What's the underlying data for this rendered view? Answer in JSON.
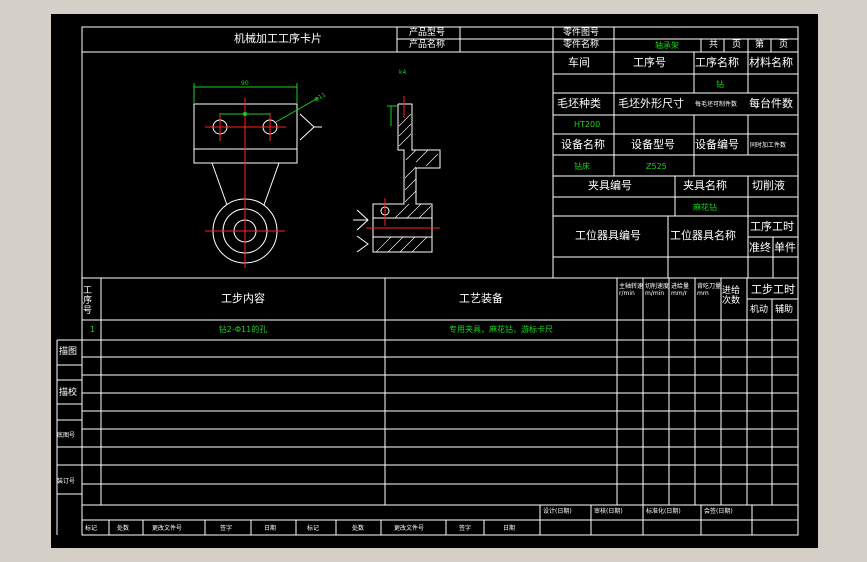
{
  "card": {
    "title": "机械加工工序卡片",
    "product_model_label": "产品型号",
    "product_name_label": "产品名称",
    "part_number_label": "零件图号",
    "part_name_label": "零件名称",
    "part_name_value": "轴承架",
    "total_label": "共",
    "page_label": "页",
    "sheet_label": "第",
    "sheet_page_label": "页"
  },
  "info": {
    "workshop": "车间",
    "process_no": "工序号",
    "process_name": "工序名称",
    "material": "材料名称",
    "process_name_value": "钻",
    "blank_type": "毛坯种类",
    "blank_size": "毛坯外形尺寸",
    "blank_pieces": "每毛坯可制件数",
    "per_unit": "每台件数",
    "blank_type_value": "HT200",
    "equip_name": "设备名称",
    "equip_model": "设备型号",
    "equip_no": "设备编号",
    "concurrent": "同时加工件数",
    "equip_name_value": "钻床",
    "equip_model_value": "Z525",
    "fixture_no": "夹具编号",
    "fixture_name": "夹具名称",
    "coolant": "切削液",
    "fixture_name_value": "麻花钻",
    "station_tool_no": "工位器具编号",
    "station_tool_name": "工位器具名称",
    "proc_time": "工序工时",
    "prep_time": "准终",
    "unit_time": "单件"
  },
  "steps": {
    "headers": {
      "step_no": "工序号",
      "content": "工步内容",
      "equipment": "工艺装备",
      "spindle_speed": "主轴转速 r/min",
      "cut_speed": "切削速度 m/min",
      "feed": "进给量 mm/r",
      "depth": "背吃刀量 mm",
      "passes": "进给次数",
      "step_time": "工步工时",
      "machine": "机动",
      "aux": "辅助"
    },
    "rows": [
      {
        "no": "1",
        "content": "钻2-Φ11的孔",
        "equipment": "专用夹具，麻花钻，游标卡尺"
      }
    ]
  },
  "side_labels": {
    "trace": "描图",
    "proof": "描校",
    "base_no": "底图号",
    "binding_no": "装订号"
  },
  "footer": {
    "design": "设计(日期)",
    "review": "审核(日期)",
    "standard": "标准化(日期)",
    "sign": "会签(日期)",
    "cols": [
      "标记",
      "处数",
      "更改文件号",
      "签字",
      "日期",
      "标记",
      "处数",
      "更改文件号",
      "签字",
      "日期"
    ]
  },
  "drawing": {
    "note_label": "k4",
    "dim_label": "90",
    "dim2_label": "Φ11"
  },
  "colors": {
    "background": "#000000",
    "lines": "#ffffff",
    "values": "#19d219",
    "centerline": "#ff2020",
    "dims": "#19d219",
    "leader": "#19d219",
    "window": "#d4d0c8"
  }
}
